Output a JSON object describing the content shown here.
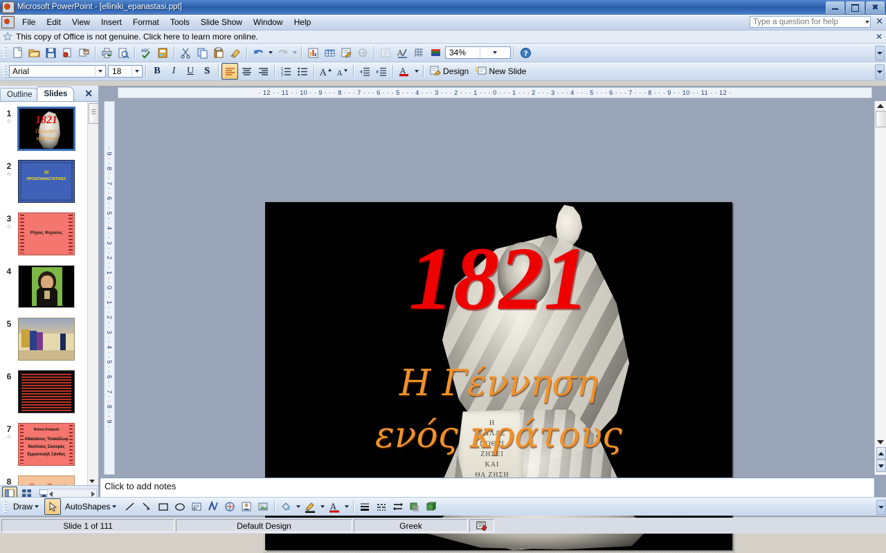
{
  "window": {
    "title": "Microsoft PowerPoint - [elliniki_epanastasi.ppt]",
    "minimize_label": "–",
    "restore_label": "❐",
    "close_label": "✕"
  },
  "menubar": {
    "items": [
      "File",
      "Edit",
      "View",
      "Insert",
      "Format",
      "Tools",
      "Slide Show",
      "Window",
      "Help"
    ],
    "help_placeholder": "Type a question for help",
    "close_label": "✕"
  },
  "notification": {
    "text": "This copy of Office is not genuine.  Click here to learn more online.",
    "close_label": "✕"
  },
  "standard_toolbar": {
    "buttons": [
      "new-document-icon",
      "open-folder-icon",
      "save-disk-icon",
      "permission-icon",
      "email-icon",
      "print-icon",
      "print-preview-icon",
      "spelling-check-icon",
      "research-icon",
      "cut-scissors-icon",
      "copy-icon",
      "paste-icon",
      "format-painter-icon",
      "undo-icon",
      "redo-icon",
      "insert-chart-icon",
      "insert-table-icon",
      "insert-diagram-icon",
      "insert-hyperlink-icon",
      "expand-all-icon",
      "show-formatting-icon",
      "show-grid-icon",
      "color-scheme-icon"
    ],
    "zoom_value": "34%",
    "help_icon": "help-question-icon",
    "overflow_label": "toolbar-options"
  },
  "formatting_toolbar": {
    "font_name": "Arial",
    "font_size": "18",
    "bold_label": "B",
    "italic_label": "I",
    "underline_label": "U",
    "shadow_label": "S",
    "align_left_label": "align-left",
    "align_center_label": "align-center",
    "align_right_label": "align-right",
    "numbering_label": "numbering",
    "bullets_label": "bullets",
    "increase_font_label": "A",
    "decrease_font_label": "A",
    "decrease_indent_label": "decrease-indent",
    "increase_indent_label": "increase-indent",
    "font_color_label": "A",
    "design_label": "Design",
    "new_slide_label": "New Slide"
  },
  "slide_panel": {
    "tabs": [
      {
        "label": "Outline",
        "selected": false
      },
      {
        "label": "Slides",
        "selected": true
      }
    ],
    "close_label": "✕",
    "thumbnails": [
      {
        "number": "1",
        "selected": true,
        "kind": "title-1821",
        "has_animation": true
      },
      {
        "number": "2",
        "selected": false,
        "kind": "blue-yellow-title",
        "has_animation": true,
        "line1": "ΟΙ",
        "line2": "ΠΡΟΕΠΑΝΑΣΤΑΤΙΚΕΣ"
      },
      {
        "number": "3",
        "selected": false,
        "kind": "pink-title",
        "has_animation": true,
        "line1": "Ρήγας Φεραίος"
      },
      {
        "number": "4",
        "selected": false,
        "kind": "portrait",
        "has_animation": false
      },
      {
        "number": "5",
        "selected": false,
        "kind": "scene",
        "has_animation": false
      },
      {
        "number": "6",
        "selected": false,
        "kind": "black-bullets",
        "has_animation": false
      },
      {
        "number": "7",
        "selected": false,
        "kind": "pink-bullets",
        "has_animation": true,
        "line1": "Φιλική Εταιρεία",
        "line2": "Αθανάσιος Τσακάλωφ",
        "line3": "Νικόλαος Σκουφάς",
        "line4": "Εμμανουήλ Ξάνθος"
      },
      {
        "number": "8",
        "selected": false,
        "kind": "peach-partial",
        "has_animation": false
      }
    ],
    "view_buttons": [
      "normal-view-icon",
      "slide-sorter-icon",
      "slide-show-icon"
    ]
  },
  "rulers": {
    "horizontal": "· 12 · · 11 · · 10 · · 9 · · · 8 · · · 7 · · · 6 · · · 5 · · · 4 · · · 3 · · · 2 · · · 1 · · · 0 · · · 1 · · · 2 · · · 3 · · · 4 · · · 5 · · · 6 · · · 7 · · · 8 · · · 9 · · 10 · · 11 · · 12 ·",
    "vertical": "· 9 · · 8 · · 7 · · 6 · · 5 · · 4 · · 3 · · 2 · · 1 · · 0 · · 1 · · 2 · · 3 · · 4 · · 5 · · 6 · · 7 · · 8 · · 9 ·"
  },
  "slide": {
    "background": "#000000",
    "year": "1821",
    "year_color": "#EE0000",
    "greek_line1": "Η Γέννηση",
    "greek_line2": "ενός κράτους",
    "greek_color": "#F0922B",
    "image_alt": "greek-revolution-flag-woman"
  },
  "notes": {
    "placeholder": "Click to add notes"
  },
  "drawing_toolbar": {
    "draw_label": "Draw",
    "autoshapes_label": "AutoShapes",
    "tools": [
      "select-arrow-icon",
      "line-icon",
      "arrow-icon",
      "rectangle-icon",
      "oval-icon",
      "text-box-icon",
      "wordart-icon",
      "diagram-icon",
      "clipart-icon",
      "picture-icon",
      "fill-color-icon",
      "line-color-icon",
      "font-color-icon",
      "line-style-icon",
      "dash-style-icon",
      "arrow-style-icon",
      "shadow-style-icon",
      "3d-style-icon"
    ]
  },
  "statusbar": {
    "slide_info": "Slide 1 of 111",
    "design": "Default Design",
    "language": "Greek",
    "spelling_icon": "spell-check-status-icon"
  }
}
